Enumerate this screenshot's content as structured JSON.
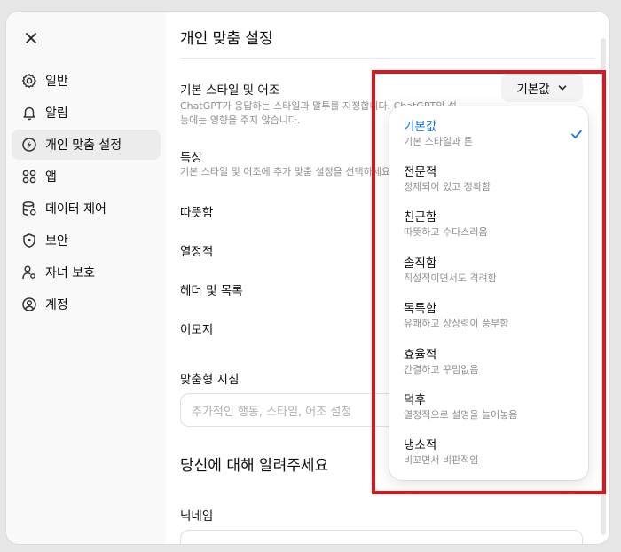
{
  "sidebar": {
    "items": [
      {
        "label": "일반",
        "icon": "gear-icon"
      },
      {
        "label": "알림",
        "icon": "bell-icon"
      },
      {
        "label": "개인 맞춤 설정",
        "icon": "personalization-icon",
        "active": true
      },
      {
        "label": "앱",
        "icon": "apps-grid-icon"
      },
      {
        "label": "데이터 제어",
        "icon": "database-icon"
      },
      {
        "label": "보안",
        "icon": "shield-icon"
      },
      {
        "label": "자녀 보호",
        "icon": "parental-icon"
      },
      {
        "label": "계정",
        "icon": "account-icon"
      }
    ]
  },
  "main": {
    "title": "개인 맞춤 설정",
    "style": {
      "label": "기본 스타일 및 어조",
      "desc_line1": "ChatGPT가 응답하는 스타일과 말투를 지정합니다. ChatGPT의 성",
      "desc_line2": "능에는 영향을 주지 않습니다.",
      "selected": "기본값"
    },
    "traits": {
      "label": "특성",
      "desc": "기본 스타일 및 어조에 추가 맞춤 설정을 선택하세요."
    },
    "toggles": [
      "따뜻함",
      "열정적",
      "헤더 및 목록",
      "이모지"
    ],
    "instructions": {
      "label": "맞춤형 지침",
      "placeholder": "추가적인 행동, 스타일, 어조 설정"
    },
    "about": {
      "title": "당신에 대해 알려주세요",
      "nickname_label": "닉네임"
    }
  },
  "dropdown": {
    "options": [
      {
        "title": "기본값",
        "subtitle": "기본 스타일과 톤",
        "selected": true
      },
      {
        "title": "전문적",
        "subtitle": "정제되어 있고 정확함"
      },
      {
        "title": "친근함",
        "subtitle": "따뜻하고 수다스러움"
      },
      {
        "title": "솔직함",
        "subtitle": "직설적이면서도 격려함"
      },
      {
        "title": "독특함",
        "subtitle": "유쾌하고 상상력이 풍부함"
      },
      {
        "title": "효율적",
        "subtitle": "간결하고 꾸밈없음"
      },
      {
        "title": "덕후",
        "subtitle": "열정적으로 설명을 늘어놓음"
      },
      {
        "title": "냉소적",
        "subtitle": "비꼬면서 비판적임"
      }
    ]
  },
  "colors": {
    "accent": "#1a73e8",
    "highlight": "#e1141b"
  }
}
